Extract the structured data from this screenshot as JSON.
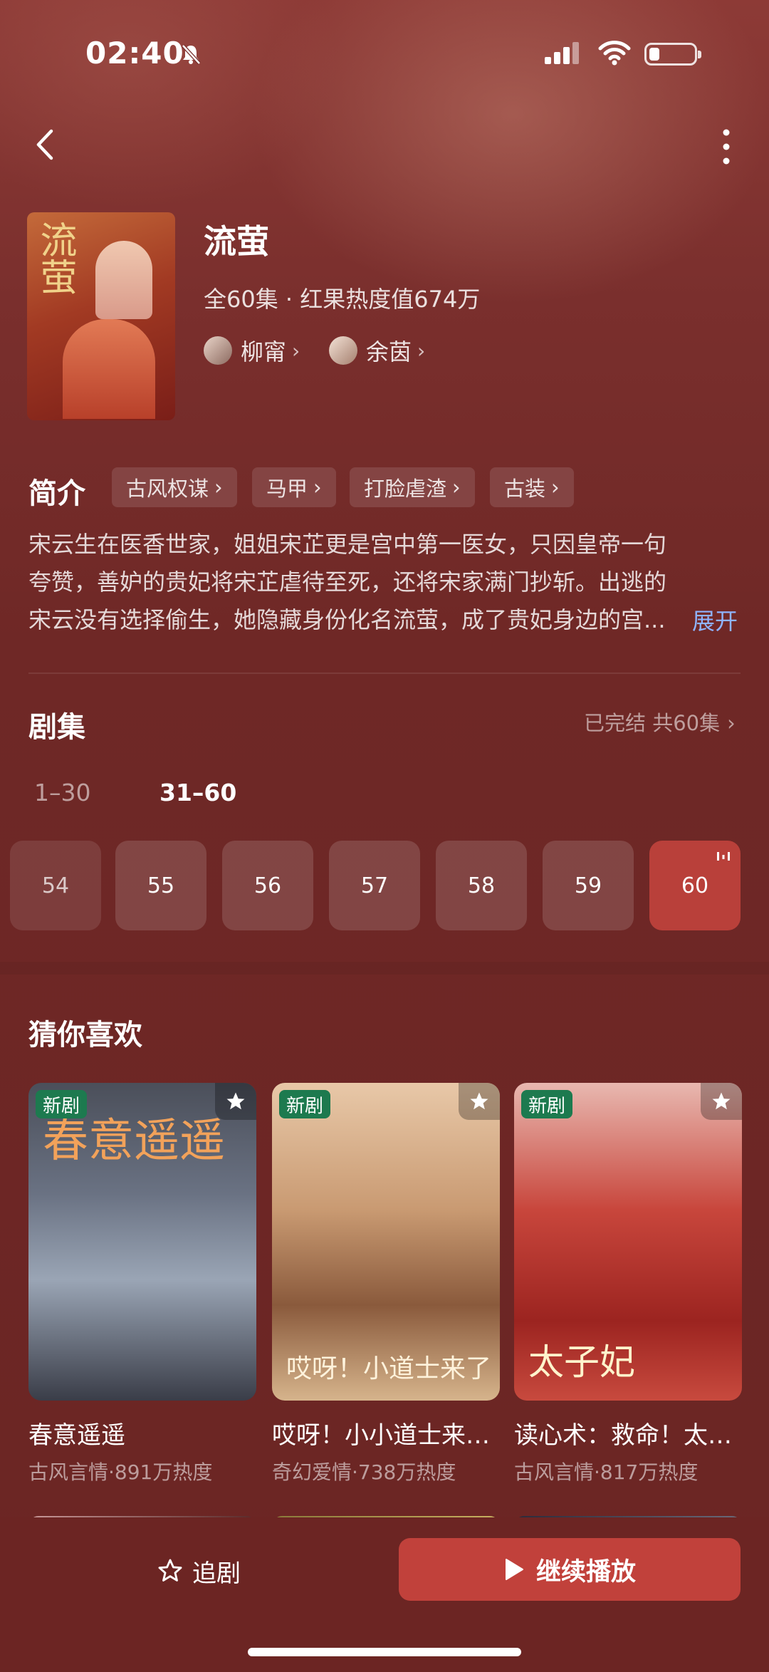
{
  "status_bar": {
    "time": "02:40"
  },
  "drama": {
    "title": "流萤",
    "meta": "全60集 · 红果热度值674万",
    "cast": [
      {
        "name": "柳甯"
      },
      {
        "name": "余茵"
      }
    ]
  },
  "intro": {
    "heading": "简介",
    "tags": [
      "古风权谋",
      "马甲",
      "打脸虐渣",
      "古装"
    ],
    "description": "宋云生在医香世家，姐姐宋芷更是宫中第一医女，只因皇帝一句夸赞，善妒的贵妃将宋芷虐待至死，还将宋家满门抄斩。出逃的宋云没有选择偷生，她隐藏身份化名流萤，成了贵妃身边的宫...",
    "expand_label": "展开"
  },
  "episodes": {
    "heading": "剧集",
    "status": "已完结 共60集",
    "ranges": [
      {
        "label": "1–30",
        "selected": false
      },
      {
        "label": "31–60",
        "selected": true
      }
    ],
    "items": [
      "54",
      "55",
      "56",
      "57",
      "58",
      "59",
      "60"
    ],
    "current": "60"
  },
  "recommend": {
    "heading": "猜你喜欢",
    "badge": "新剧",
    "cards": [
      {
        "title": "春意遥遥",
        "sub": "古风言情·891万热度",
        "poster_title": "春意遥遥"
      },
      {
        "title": "哎呀！小小道士来…",
        "sub": "奇幻爱情·738万热度",
        "poster_title": "哎呀！小道士来了"
      },
      {
        "title": "读心术：救命！太…",
        "sub": "古风言情·817万热度",
        "poster_title": "太子妃"
      }
    ]
  },
  "bottom": {
    "follow_label": "追剧",
    "continue_label": "继续播放"
  },
  "colors": {
    "accent": "#c1413b",
    "background": "#6e2524",
    "link": "#8fb4ff",
    "new_badge": "#1d7a4f"
  }
}
